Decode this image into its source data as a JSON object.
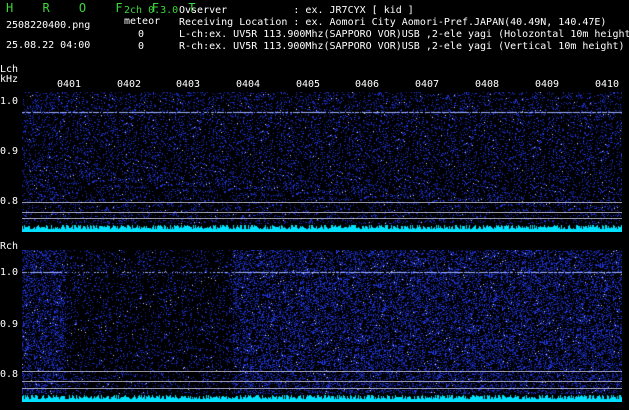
{
  "header": {
    "app_title": "H R O F F T",
    "filename": "2508220400.png",
    "datetime": "25.08.22 04:00",
    "mode": "2ch 0.3.0",
    "meteor_label": "meteor",
    "meteor_count_l": "0",
    "meteor_count_r": "0",
    "info_lines": [
      "Ovserver           : ex. JR7CYX [ kid ]",
      "Receiving Location : ex. Aomori City Aomori-Pref.JAPAN(40.49N, 140.47E)",
      "L-ch:ex. UV5R 113.900Mhz(SAPPORO VOR)USB ,2-ele yagi (Holozontal 10m height)",
      "R-ch:ex. UV5R 113.900Mhz(SAPPORO VOR)USB ,2-ele yagi (Vertical 10m height)"
    ]
  },
  "left_channel": {
    "label": "Lch",
    "unit": "kHz",
    "yticks": [
      "1.0",
      "0.9",
      "0.8"
    ]
  },
  "right_channel": {
    "label": "Rch",
    "yticks": [
      "1.0",
      "0.9",
      "0.8"
    ]
  },
  "time_ticks": [
    "0401",
    "0402",
    "0403",
    "0404",
    "0405",
    "0406",
    "0407",
    "0408",
    "0409",
    "0410"
  ],
  "colors": {
    "background": "#000000",
    "text": "#ffffff",
    "title": "#3cd83c",
    "noise": "#1a2cc8",
    "carrier": "#9db0ff",
    "baseline": "#00e0ff"
  }
}
